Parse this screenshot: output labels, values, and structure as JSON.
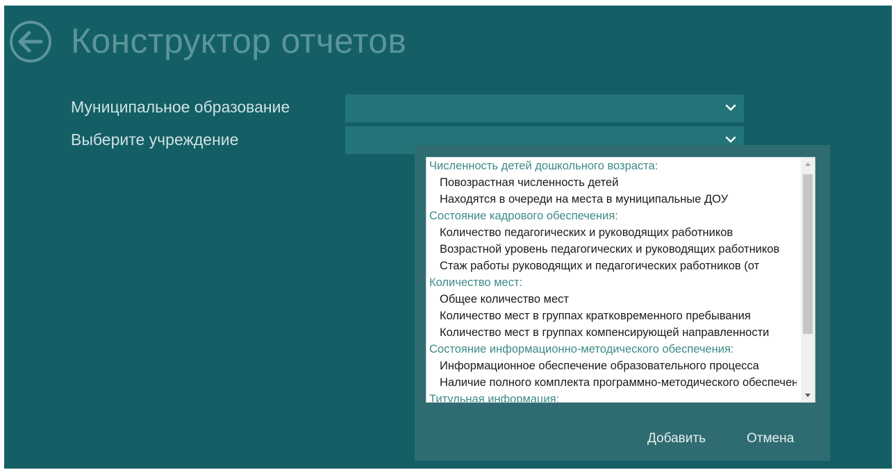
{
  "page": {
    "title": "Конструктор отчетов",
    "back_icon": "arrow-left-circle-icon"
  },
  "form": {
    "municipality_label": "Муниципальное образование",
    "municipality_value": "",
    "institution_label": "Выберите учреждение",
    "institution_value": ""
  },
  "dialog": {
    "list": [
      {
        "type": "category",
        "label": "Численность детей дошкольного возраста:"
      },
      {
        "type": "item",
        "label": "Повозрастная численность детей"
      },
      {
        "type": "item",
        "label": "Находятся в очереди на места в муниципальные ДОУ"
      },
      {
        "type": "category",
        "label": "Состояние кадрового обеспечения:"
      },
      {
        "type": "item",
        "label": "Количество педагогических и руководящих работников"
      },
      {
        "type": "item",
        "label": "Возрастной уровень педагогических и руководящих работников"
      },
      {
        "type": "item",
        "label": "Стаж работы руководящих и педагогических работников (от"
      },
      {
        "type": "category",
        "label": "Количество мест:"
      },
      {
        "type": "item",
        "label": "Общее количество мест"
      },
      {
        "type": "item",
        "label": "Количество мест в группах кратковременного пребывания"
      },
      {
        "type": "item",
        "label": "Количество мест в группах компенсирующей направленности"
      },
      {
        "type": "category",
        "label": "Состояние информационно-методического обеспечения:"
      },
      {
        "type": "item",
        "label": "Информационное обеспечение образовательного процесса"
      },
      {
        "type": "item",
        "label": "Наличие полного комплекта программно-методического обеспечения"
      },
      {
        "type": "category",
        "label": "Титульная информация:"
      }
    ],
    "add_label": "Добавить",
    "cancel_label": "Отмена"
  },
  "colors": {
    "background": "#135f65",
    "dialog": "#2f6c71",
    "select": "#23757a",
    "category_text": "#3c8a88"
  }
}
